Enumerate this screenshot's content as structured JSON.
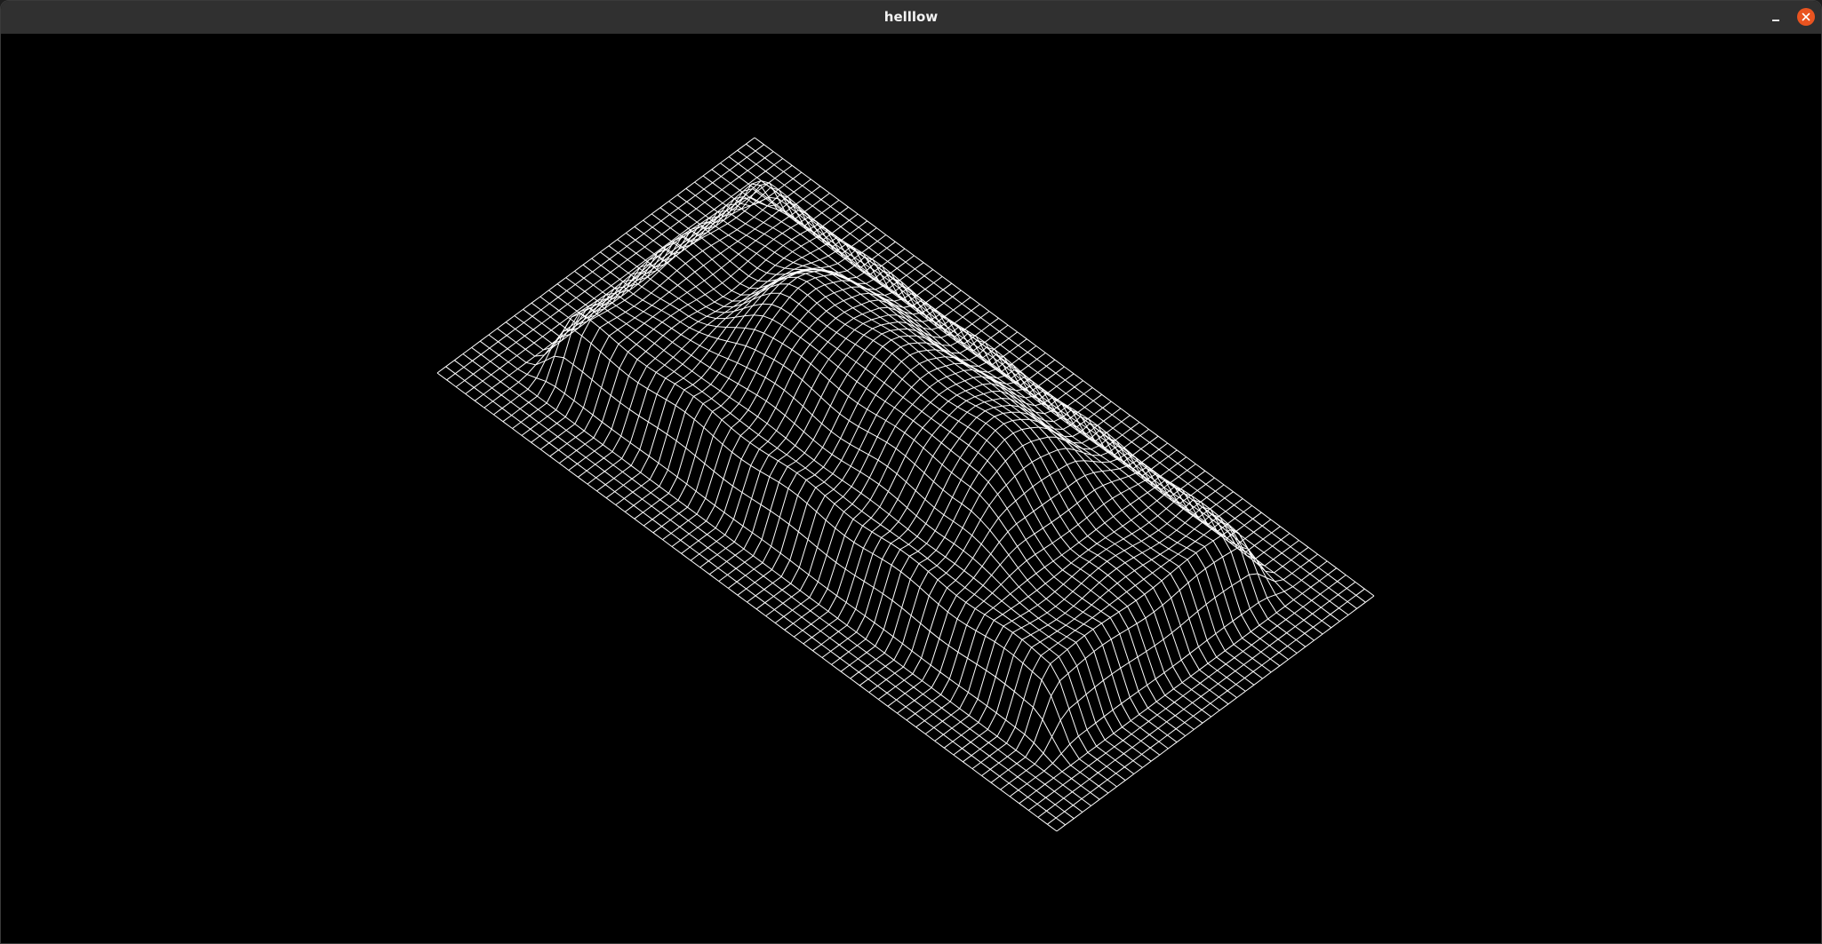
{
  "window": {
    "title": "helllow"
  },
  "titlebar": {
    "icons": {
      "minimize": "minimize-icon",
      "close": "close-icon"
    },
    "close_color": "#e95420"
  },
  "viewport": {
    "background": "#000000",
    "wire_color": "#ffffff",
    "content": "wireframe-terrain-mesh"
  }
}
